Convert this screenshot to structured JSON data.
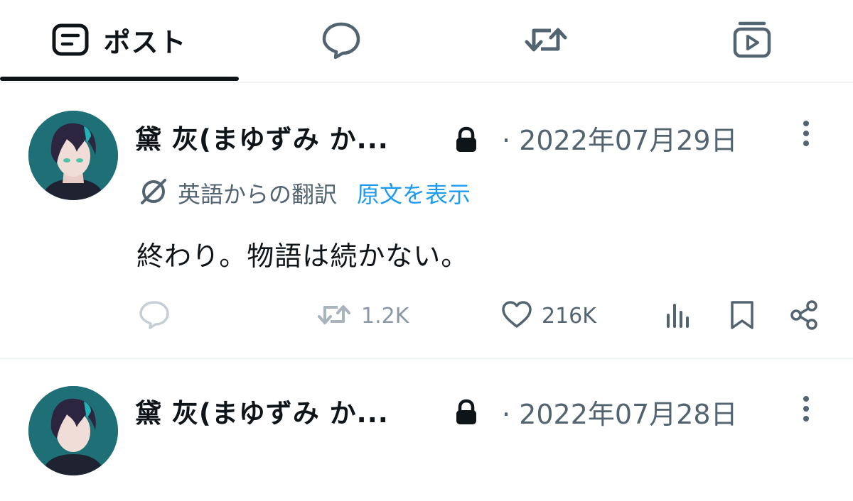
{
  "tabs": {
    "posts_label": "ポスト"
  },
  "posts": [
    {
      "display_name": "黛 灰(まゆずみ か...",
      "date": "· 2022年07月29日",
      "translation_label": "英語からの翻訳",
      "show_original_label": "原文を表示",
      "text": "終わり。物語は続かない。",
      "reposts": "1.2K",
      "likes": "216K"
    },
    {
      "display_name": "黛 灰(まゆずみ か...",
      "date": "· 2022年07月28日"
    }
  ],
  "colors": {
    "text_primary": "#0f1419",
    "text_secondary": "#536471",
    "link": "#1d9bf0",
    "divider": "#eff3f4",
    "avatar_bg": "#1e6f76"
  },
  "icons": {
    "posts_tab": "post-icon",
    "replies_tab": "speech-bubble-icon",
    "reposts_tab": "repost-icon",
    "media_tab": "media-icon",
    "translate": "translate-icon",
    "lock": "lock-icon",
    "more": "more-vertical-icon",
    "reply": "reply-icon",
    "repost": "repost-icon",
    "like": "heart-icon",
    "views": "views-icon",
    "bookmark": "bookmark-icon",
    "share": "share-icon"
  }
}
